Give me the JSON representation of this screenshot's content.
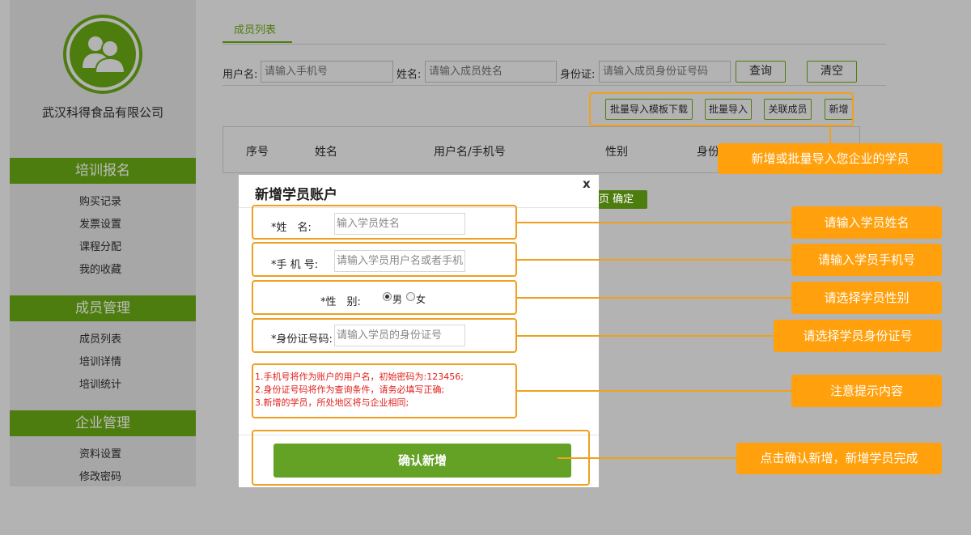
{
  "sidebar": {
    "company": "武汉科得食品有限公司",
    "sections": [
      {
        "title": "培训报名",
        "items": [
          "购买记录",
          "发票设置",
          "课程分配",
          "我的收藏"
        ]
      },
      {
        "title": "成员管理",
        "items": [
          "成员列表",
          "培训详情",
          "培训统计"
        ]
      },
      {
        "title": "企业管理",
        "items": [
          "资料设置",
          "修改密码"
        ]
      }
    ],
    "avatar_icon": "users-icon"
  },
  "main": {
    "tab": "成员列表",
    "filters": {
      "username_label": "用户名:",
      "username_placeholder": "请输入手机号",
      "name_label": "姓名:",
      "name_placeholder": "请输入成员姓名",
      "id_label": "身份证:",
      "id_placeholder": "请输入成员身份证号码",
      "query_btn": "查询",
      "clear_btn": "清空"
    },
    "actions": [
      "批量导入模板下载",
      "批量导入",
      "关联成员",
      "新增"
    ],
    "table_headers": [
      "序号",
      "姓名",
      "用户名/手机号",
      "性别",
      "身份"
    ],
    "pager": {
      "page_suffix": "页",
      "confirm": "确定"
    }
  },
  "modal": {
    "title": "新增学员账户",
    "close": "x",
    "name_label": "*姓　名:",
    "name_placeholder": "输入学员姓名",
    "phone_label": "*手 机 号:",
    "phone_placeholder": "请输入学员用户名或者手机",
    "gender_label": "*性　别:",
    "gender_options": [
      "男",
      "女"
    ],
    "gender_selected": "男",
    "id_label": "*身份证号码:",
    "id_placeholder": "请输入学员的身份证号",
    "notices": [
      "1.手机号将作为账户的用户名，初始密码为:123456;",
      "2.身份证号码将作为查询条件，请务必填写正确;",
      "3.新增的学员，所处地区将与企业相同;"
    ],
    "confirm": "确认新增"
  },
  "annotations": {
    "add": "新增或批量导入您企业的学员",
    "name": "请输入学员姓名",
    "phone": "请输入学员手机号",
    "gender": "请选择学员性别",
    "id": "请选择学员身份证号",
    "notice": "注意提示内容",
    "confirm": "点击确认新增，新增学员完成"
  },
  "colors": {
    "brand": "#4e7d0f",
    "accent": "#ffa00c",
    "confirm": "#64a226",
    "notice": "#e0201c"
  }
}
